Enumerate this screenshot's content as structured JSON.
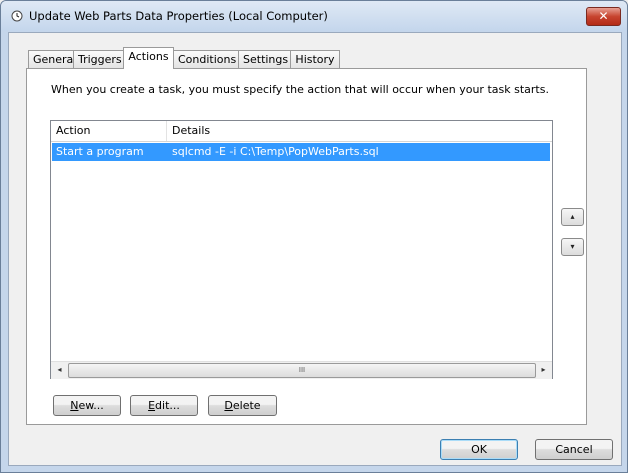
{
  "window": {
    "title": "Update Web Parts Data Properties (Local Computer)",
    "close_label": "✕"
  },
  "tabs": [
    {
      "label": "General",
      "active": false
    },
    {
      "label": "Triggers",
      "active": false
    },
    {
      "label": "Actions",
      "active": true
    },
    {
      "label": "Conditions",
      "active": false
    },
    {
      "label": "Settings",
      "active": false
    },
    {
      "label": "History",
      "active": false
    }
  ],
  "actions_panel": {
    "description": "When you create a task, you must specify the action that will occur when your task starts.",
    "columns": [
      "Action",
      "Details"
    ],
    "rows": [
      {
        "action": "Start a program",
        "details": "sqlcmd -E -i  C:\\Temp\\PopWebParts.sql",
        "selected": true
      }
    ],
    "scrollbar": {
      "left": "◂",
      "right": "▸",
      "grip": "III"
    },
    "move_up": "▴",
    "move_down": "▾",
    "buttons": {
      "new": {
        "accel": "N",
        "rest": "ew..."
      },
      "edit": {
        "accel": "E",
        "rest": "dit..."
      },
      "delete": {
        "accel": "D",
        "rest": "elete"
      }
    }
  },
  "footer": {
    "ok_label": "OK",
    "cancel_label": "Cancel"
  },
  "colors": {
    "selection": "#3399ff",
    "close": "#c7442f"
  }
}
